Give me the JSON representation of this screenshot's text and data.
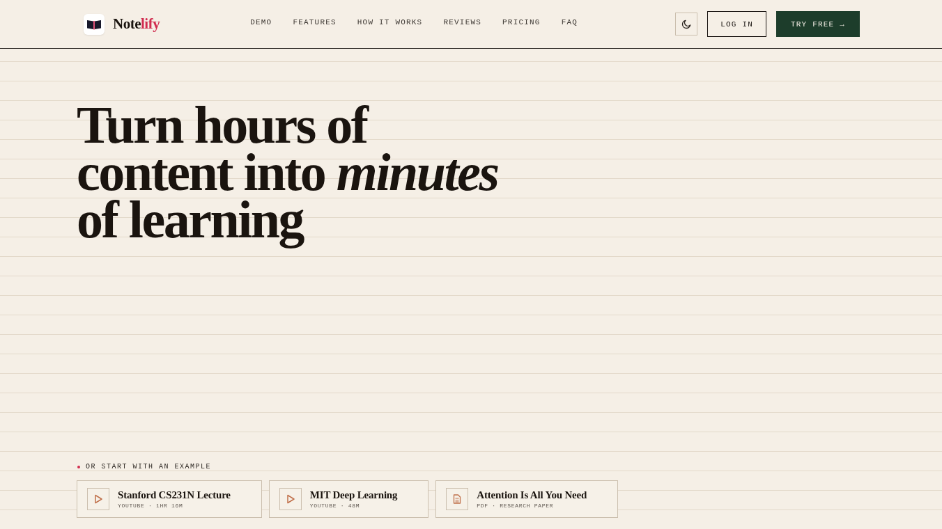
{
  "header": {
    "brand": {
      "name": "Note",
      "accent": "lify"
    },
    "nav": [
      "DEMO",
      "FEATURES",
      "HOW IT WORKS",
      "REVIEWS",
      "PRICING",
      "FAQ"
    ],
    "login": "LOG IN",
    "cta": "TRY FREE →"
  },
  "hero": {
    "headline": "Turn hours of content into *minutes* of learning"
  },
  "examples": {
    "label": "OR START WITH AN EXAMPLE",
    "items": [
      {
        "kind": "video",
        "title": "Stanford CS231N Lecture",
        "meta": "YOUTUBE · 1HR 16M"
      },
      {
        "kind": "video",
        "title": "MIT Deep Learning",
        "meta": "YOUTUBE · 48M"
      },
      {
        "kind": "document",
        "title": "Attention Is All You Need",
        "meta": "PDF · RESEARCH PAPER"
      }
    ]
  }
}
